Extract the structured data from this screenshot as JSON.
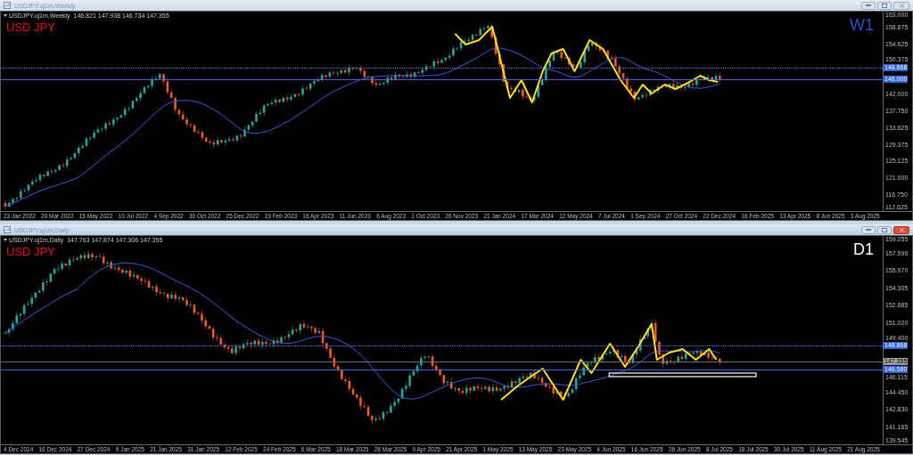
{
  "windows": [
    {
      "kind": "weekly",
      "title": "USDJPY.oj1m,Weekly",
      "active": false,
      "header": "USDJPY.oj1m,Weekly  146.821 147.938 146.734 147.355",
      "symbol": "USD JPY",
      "timeframe": {
        "text": "W1",
        "color": "#2f4fc8"
      },
      "price_ticks": [
        "163.000",
        "158.875",
        "154.625",
        "150.375",
        "142.000",
        "137.750",
        "133.625",
        "129.375",
        "125.125",
        "121.000",
        "116.750",
        "112.625"
      ],
      "badges": [
        {
          "text": "148.868",
          "kind": "bid"
        },
        {
          "text": "146.000",
          "kind": "level"
        }
      ],
      "dates": [
        "23 Jan 2022",
        "20 Mar 2022",
        "15 May 2022",
        "10 Jul 2022",
        "4 Sep 2022",
        "30 Oct 2022",
        "25 Dec 2022",
        "19 Feb 2023",
        "16 Apr 2023",
        "11 Jun 2023",
        "6 Aug 2023",
        "1 Oct 2023",
        "26 Nov 2023",
        "21 Jan 2024",
        "17 Mar 2024",
        "12 May 2024",
        "7 Jul 2024",
        "1 Sep 2024",
        "27 Oct 2024",
        "22 Dec 2024",
        "16 Feb 2025",
        "13 Apr 2025",
        "8 Jun 2025",
        "3 Aug 2025"
      ]
    },
    {
      "kind": "daily",
      "title": "USDJPY.oj1m,Daily",
      "active": true,
      "header": "USDJPY.oj1m,Daily  147.763 147.874 147.306 147.355",
      "symbol": "USD JPY",
      "timeframe": {
        "text": "D1",
        "color": "#ffffff"
      },
      "price_ticks": [
        "159.255",
        "157.590",
        "155.970",
        "154.305",
        "152.685",
        "151.020",
        "149.400",
        "146.115",
        "144.450",
        "142.830",
        "141.165",
        "139.545"
      ],
      "badges": [
        {
          "text": "148.868",
          "kind": "bid"
        },
        {
          "text": "147.355",
          "kind": "last"
        },
        {
          "text": "146.580",
          "kind": "level"
        }
      ],
      "dates": [
        "4 Dec 2024",
        "16 Dec 2024",
        "27 Dec 2024",
        "9 Jan 2025",
        "21 Jan 2025",
        "31 Jan 2025",
        "12 Feb 2025",
        "24 Feb 2025",
        "6 Mar 2025",
        "18 Mar 2025",
        "28 Mar 2025",
        "9 Apr 2025",
        "21 Apr 2025",
        "1 May 2025",
        "13 May 2025",
        "23 May 2025",
        "4 Jun 2025",
        "16 Jun 2025",
        "26 Jun 2025",
        "8 Jul 2025",
        "18 Jul 2025",
        "30 Jul 2025",
        "11 Aug 2025",
        "21 Aug 2025"
      ]
    }
  ]
}
